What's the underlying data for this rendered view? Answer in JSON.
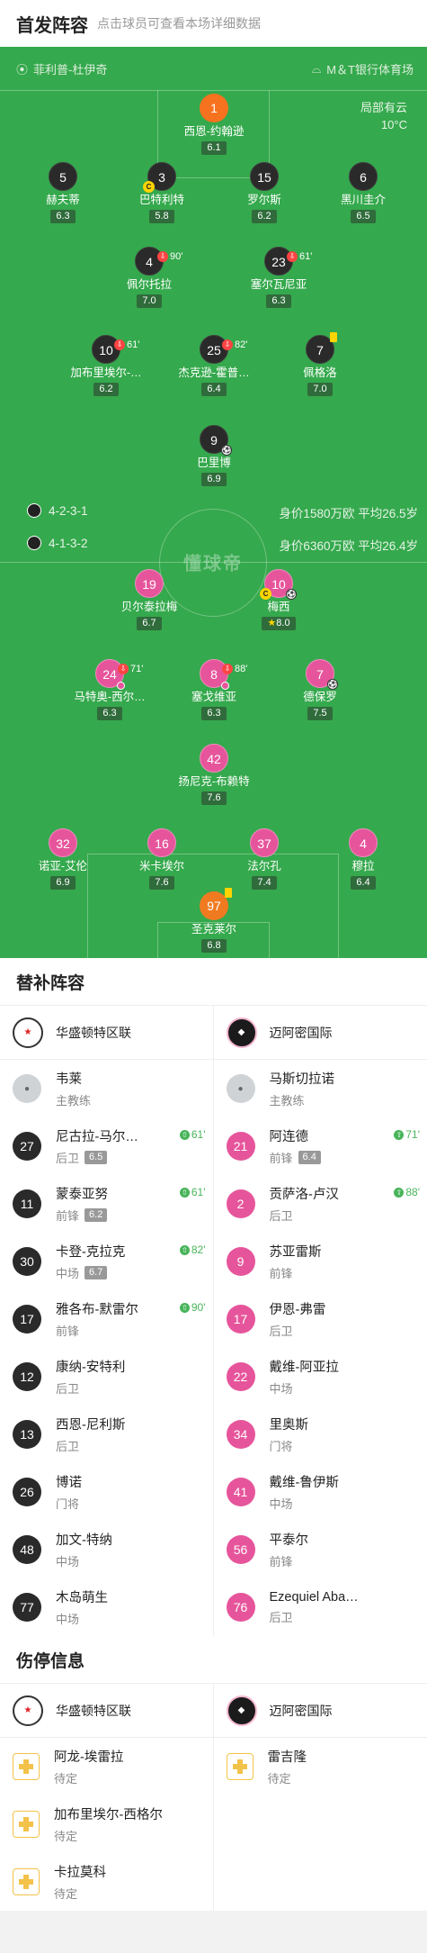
{
  "header": {
    "title": "首发阵容",
    "tip": "点击球员可查看本场详细数据"
  },
  "venue": {
    "referee": "菲利普-杜伊奇",
    "stadium": "M＆T银行体育场",
    "weather": "局部有云",
    "temperature": "10°C"
  },
  "watermark": "懂球帝",
  "home": {
    "formation": "4-2-3-1",
    "summary": "身价1580万欧 平均26.5岁",
    "players": [
      {
        "num": "1",
        "name": "西恩-约翰逊",
        "rating": "6.1"
      },
      {
        "num": "5",
        "name": "赫夫蒂",
        "rating": "6.3"
      },
      {
        "num": "3",
        "name": "巴特利特",
        "rating": "5.8"
      },
      {
        "num": "15",
        "name": "罗尔斯",
        "rating": "6.2"
      },
      {
        "num": "6",
        "name": "黑川圭介",
        "rating": "6.5"
      },
      {
        "num": "4",
        "name": "佩尔托拉",
        "rating": "7.0",
        "sub": "90'"
      },
      {
        "num": "23",
        "name": "塞尔瓦尼亚",
        "rating": "6.3",
        "sub": "61'"
      },
      {
        "num": "10",
        "name": "加布里埃尔-…",
        "rating": "6.2",
        "sub": "61'"
      },
      {
        "num": "25",
        "name": "杰克逊-霍普…",
        "rating": "6.4",
        "sub": "82'"
      },
      {
        "num": "7",
        "name": "佩格洛",
        "rating": "7.0"
      },
      {
        "num": "9",
        "name": "巴里博",
        "rating": "6.9"
      }
    ]
  },
  "away": {
    "formation": "4-1-3-2",
    "summary": "身价6360万欧 平均26.4岁",
    "players": [
      {
        "num": "19",
        "name": "贝尔泰拉梅",
        "rating": "6.7"
      },
      {
        "num": "10",
        "name": "梅西",
        "rating": "8.0"
      },
      {
        "num": "24",
        "name": "马特奥-西尔…",
        "rating": "6.3",
        "sub": "71'"
      },
      {
        "num": "8",
        "name": "塞戈维亚",
        "rating": "6.3",
        "sub": "88'"
      },
      {
        "num": "7",
        "name": "德保罗",
        "rating": "7.5"
      },
      {
        "num": "42",
        "name": "扬尼克-布赖特",
        "rating": "7.6"
      },
      {
        "num": "32",
        "name": "诺亚-艾伦",
        "rating": "6.9"
      },
      {
        "num": "16",
        "name": "米卡埃尔",
        "rating": "7.6"
      },
      {
        "num": "37",
        "name": "法尔孔",
        "rating": "7.4"
      },
      {
        "num": "4",
        "name": "穆拉",
        "rating": "6.4"
      },
      {
        "num": "97",
        "name": "圣克莱尔",
        "rating": "6.8"
      }
    ]
  },
  "subs": {
    "title": "替补阵容",
    "home_team": "华盛顿特区联",
    "away_team": "迈阿密国际",
    "home_coach": {
      "name": "韦莱",
      "role": "主教练"
    },
    "away_coach": {
      "name": "马斯切拉诺",
      "role": "主教练"
    },
    "home": [
      {
        "num": "27",
        "name": "尼古拉-马尔…",
        "pos": "后卫",
        "rating": "6.5",
        "time": "61'"
      },
      {
        "num": "11",
        "name": "蒙泰亚努",
        "pos": "前锋",
        "rating": "6.2",
        "time": "61'"
      },
      {
        "num": "30",
        "name": "卡登-克拉克",
        "pos": "中场",
        "rating": "6.7",
        "time": "82'"
      },
      {
        "num": "17",
        "name": "雅各布-默雷尔",
        "pos": "前锋",
        "time": "90'"
      },
      {
        "num": "12",
        "name": "康纳-安特利",
        "pos": "后卫"
      },
      {
        "num": "13",
        "name": "西恩-尼利斯",
        "pos": "后卫"
      },
      {
        "num": "26",
        "name": "博诺",
        "pos": "门将"
      },
      {
        "num": "48",
        "name": "加文-特纳",
        "pos": "中场"
      },
      {
        "num": "77",
        "name": "木岛萌生",
        "pos": "中场"
      }
    ],
    "away": [
      {
        "num": "21",
        "name": "阿连德",
        "pos": "前锋",
        "rating": "6.4",
        "time": "71'"
      },
      {
        "num": "2",
        "name": "贡萨洛-卢汉",
        "pos": "后卫",
        "time": "88'"
      },
      {
        "num": "9",
        "name": "苏亚雷斯",
        "pos": "前锋"
      },
      {
        "num": "17",
        "name": "伊恩-弗雷",
        "pos": "后卫"
      },
      {
        "num": "22",
        "name": "戴维-阿亚拉",
        "pos": "中场"
      },
      {
        "num": "34",
        "name": "里奥斯",
        "pos": "门将"
      },
      {
        "num": "41",
        "name": "戴维-鲁伊斯",
        "pos": "中场"
      },
      {
        "num": "56",
        "name": "平泰尔",
        "pos": "前锋"
      },
      {
        "num": "76",
        "name": "Ezequiel Aba…",
        "pos": "后卫"
      }
    ]
  },
  "injuries": {
    "title": "伤停信息",
    "home": [
      {
        "name": "阿龙-埃雷拉",
        "status": "待定"
      },
      {
        "name": "加布里埃尔-西格尔",
        "status": "待定"
      },
      {
        "name": "卡拉莫科",
        "status": "待定"
      }
    ],
    "away": [
      {
        "name": "雷吉隆",
        "status": "待定"
      }
    ]
  },
  "colors": {
    "pitch": "#35a94d",
    "home": "#2a2a2a",
    "away": "#e6559b",
    "sub_in": "#48b45a"
  }
}
